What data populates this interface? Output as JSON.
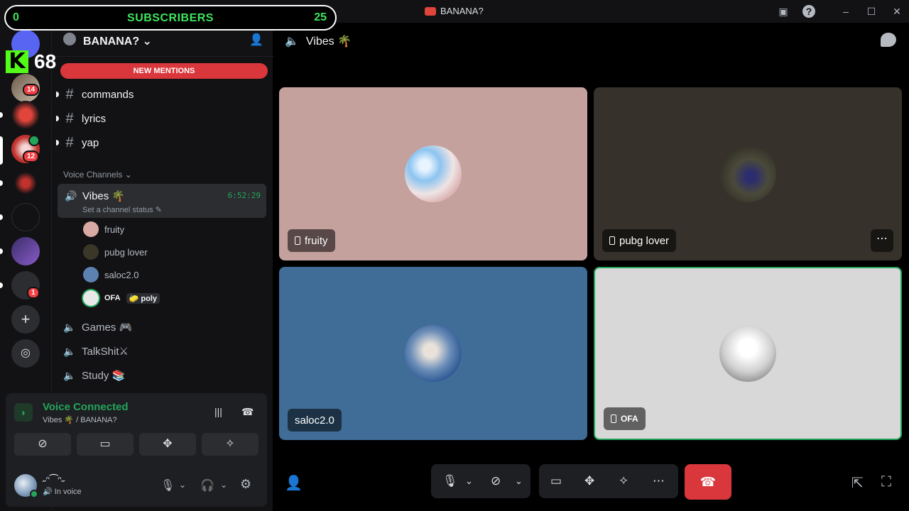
{
  "window": {
    "title": "BANANA?"
  },
  "overlay": {
    "subs_left": "0",
    "subs_label": "SUBSCRIBERS",
    "subs_count": "25",
    "kick_logo": "K",
    "kick_count": "68"
  },
  "servers": {
    "badges": [
      "14",
      "12",
      "1"
    ]
  },
  "guild": {
    "name": "BANANA?",
    "new_mentions": "NEW MENTIONS",
    "text_channels": [
      "commands",
      "lyrics",
      "yap"
    ],
    "voice_category": "Voice Channels"
  },
  "active_voice": {
    "name": "Vibes 🌴",
    "timer": "6:52:29",
    "status": "Set a channel status ✎",
    "users": [
      {
        "name": "fruity",
        "color": "#d9a9a4"
      },
      {
        "name": "pubg lover",
        "color": "#3a3628"
      },
      {
        "name": "saloc2.0",
        "color": "#5b82b0"
      },
      {
        "name": "OFA",
        "tag": "🧽 poly",
        "color": "#e8e8e8"
      }
    ]
  },
  "voice_channels": [
    "Games 🎮",
    "TalkShit⚔",
    "Study 📚"
  ],
  "voice_panel": {
    "title": "Voice Connected",
    "subtitle": "Vibes 🌴 / BANANA?"
  },
  "user_panel": {
    "name": "˶ᵔ⁀ᵔ˶",
    "status": "🔊 In voice"
  },
  "main": {
    "channel": "Vibes 🌴",
    "tiles": [
      {
        "name": "fruity",
        "bg": "#c4a19d"
      },
      {
        "name": "pubg lover",
        "bg": "#36312b"
      },
      {
        "name": "saloc2.0",
        "bg": "#3f6d97"
      },
      {
        "name": "OFA",
        "bg": "#d8d8d8"
      }
    ]
  },
  "colors": {
    "accent_green": "#23a55a",
    "danger_red": "#da373c",
    "kick_green": "#53fc18"
  }
}
